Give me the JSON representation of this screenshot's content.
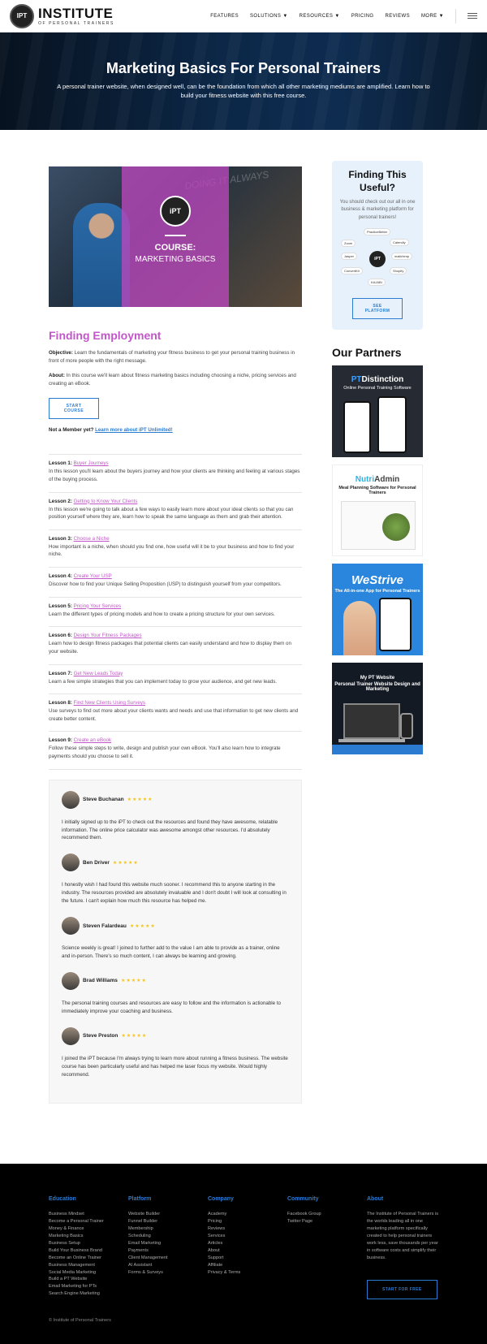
{
  "header": {
    "logo_mark": "IPT",
    "logo_main": "INSTITUTE",
    "logo_sub": "OF PERSONAL TRAINERS",
    "nav": [
      "FEATURES",
      "SOLUTIONS ▼",
      "RESOURCES ▼",
      "PRICING",
      "REVIEWS",
      "MORE ▼"
    ]
  },
  "hero": {
    "title": "Marketing Basics For Personal Trainers",
    "subtitle": "A personal trainer website, when designed well, can be the foundation from which all other marketing mediums are amplified. Learn how to build your fitness website with this free course."
  },
  "course_image": {
    "badge": "iPT",
    "line1": "COURSE:",
    "line2": "MARKETING BASICS",
    "wall_text": "DOING IT ALWAYS"
  },
  "main": {
    "title": "Finding Employment",
    "objective_label": "Objective:",
    "objective": " Learn the fundamentals of marketing your fitness business to get your personal training business in front of more people with the right message.",
    "about_label": "About:",
    "about": " In this course we'll learn about fitness marketing basics including choosing a niche, pricing services and creating an eBook.",
    "start_button": "START COURSE",
    "member_text": "Not a Member yet? ",
    "member_link": "Learn more about iPT Unlimited!"
  },
  "lessons": [
    {
      "num": "Lesson 1: ",
      "title": "Buyer Journeys",
      "desc": "In this lesson you'll learn about the buyers journey and how your clients are thinking and feeling at various stages of the buying process."
    },
    {
      "num": "Lesson 2: ",
      "title": "Getting to Know Your Clients",
      "desc": "In this lesson we're going to talk about a few ways to easily learn more about your ideal clients so that you can position yourself where they are, learn how to speak the same language as them and grab their attention."
    },
    {
      "num": "Lesson 3: ",
      "title": "Choose a Niche",
      "desc": "How important is a niche, when should you find one, how useful will it be to your business and how to find your niche."
    },
    {
      "num": "Lesson 4: ",
      "title": "Create Your USP",
      "desc": "Discover how to find your Unique Selling Proposition (USP) to distinguish yourself from your competitors."
    },
    {
      "num": "Lesson 5: ",
      "title": "Pricing Your Services",
      "desc": "Learn the different types of pricing models and how to create a pricing structure for your own services."
    },
    {
      "num": "Lesson 6: ",
      "title": "Design Your Fitness Packages",
      "desc": "Learn how to design fitness packages that potential clients can easily understand and how to display them on your website."
    },
    {
      "num": "Lesson 7: ",
      "title": "Get New Leads Today",
      "desc": "Learn a few simple strategies that you can implement today to grow your audience, and get new leads."
    },
    {
      "num": "Lesson 8: ",
      "title": "Find New Clients Using Surveys",
      "desc": "Use surveys to find out more about your clients wants and needs and use that information to get new clients and create better content."
    },
    {
      "num": "Lesson 9: ",
      "title": "Create an eBook",
      "desc": "Follow these simple steps to write, design and publish your own eBook. You'll also learn how to integrate payments should you choose to sell it."
    }
  ],
  "reviews": [
    {
      "name": "Steve Buchanan",
      "stars": "★★★★★",
      "text": "I initially signed up to the iPT to check out the resources and found they have awesome, relatable information. The online price calculator was awesome amongst other resources. I'd absolutely recommend them."
    },
    {
      "name": "Ben Driver",
      "stars": "★★★★★",
      "text": "I honestly wish I had found this website much sooner. I recommend this to anyone starting in the industry. The resources provided are absolutely invaluable and I don't doubt I will look at consulting in the future. I can't explain how much this resource has helped me."
    },
    {
      "name": "Steven Falardeau",
      "stars": "★★★★★",
      "text": "Science weekly is great! I joined to further add to the value I am able to provide as a trainer, online and in-person. There's so much content, I can always be learning and growing."
    },
    {
      "name": "Brad Williams",
      "stars": "★★★★★",
      "text": "The personal training courses and resources are easy to follow and the information is actionable to immediately improve your coaching and business."
    },
    {
      "name": "Steve Preston",
      "stars": "★★★★★",
      "text": "I joined the iPT because I'm always trying to learn more about running a fitness business. The website course has been particularly useful and has helped me laser focus my website. Would highly recommend."
    }
  ],
  "sidebar": {
    "find_title": "Finding This Useful?",
    "find_text": "You should check out our all in one business & marketing platform for personal trainers!",
    "hub": "iPT",
    "integrations": [
      "PracticeBetter",
      "Calendly",
      "Jasper",
      "mailchimp",
      "Shopify",
      "ConvertKit",
      "Zoom",
      "KAJABI",
      "Google Calendar"
    ],
    "see_button": "SEE PLATFORM",
    "partners_title": "Our Partners",
    "ads": [
      {
        "brand_a": "PT",
        "brand_b": "Distinction",
        "tagline": "Online Personal Training Software"
      },
      {
        "brand_a": "Nutri",
        "brand_b": "Admin",
        "tagline": "Meal Planning Software for Personal Trainers"
      },
      {
        "brand": "WeStrive",
        "tagline": "The All-in-one App for Personal Trainers"
      },
      {
        "brand": "My PT Website",
        "tagline": "Personal Trainer Website Design and Marketing"
      }
    ]
  },
  "footer": {
    "columns": [
      {
        "title": "Education",
        "items": [
          "Business Mindset",
          "Become a Personal Trainer",
          "Money & Finance",
          "Marketing Basics",
          "Business Setup",
          "Build Your Business Brand",
          "Become an Online Trainer",
          "Business Management",
          "Social Media Marketing",
          "Build a PT Website",
          "Email Marketing for PTs",
          "Search Engine Marketing"
        ]
      },
      {
        "title": "Platform",
        "items": [
          "Website Builder",
          "Funnel Builder",
          "Membership",
          "Scheduling",
          "Email Marketing",
          "Payments",
          "Client Management",
          "AI Assistant",
          "Forms & Surveys"
        ]
      },
      {
        "title": "Company",
        "items": [
          "Academy",
          "Pricing",
          "Reviews",
          "Services",
          "Articles",
          "About",
          "Support",
          "Affiliate",
          "Privacy & Terms"
        ]
      },
      {
        "title": "Community",
        "items": [
          "Facebook Group",
          "Twitter Page"
        ]
      }
    ],
    "about_title": "About",
    "about_text": "The Institute of Personal Trainers is the worlds leading all in one marketing platform specifically created to help personal trainers work less, save thousands per year in software costs and simplify their business.",
    "free_button": "START FOR FREE",
    "copyright": "© Institute of Personal Trainers"
  }
}
